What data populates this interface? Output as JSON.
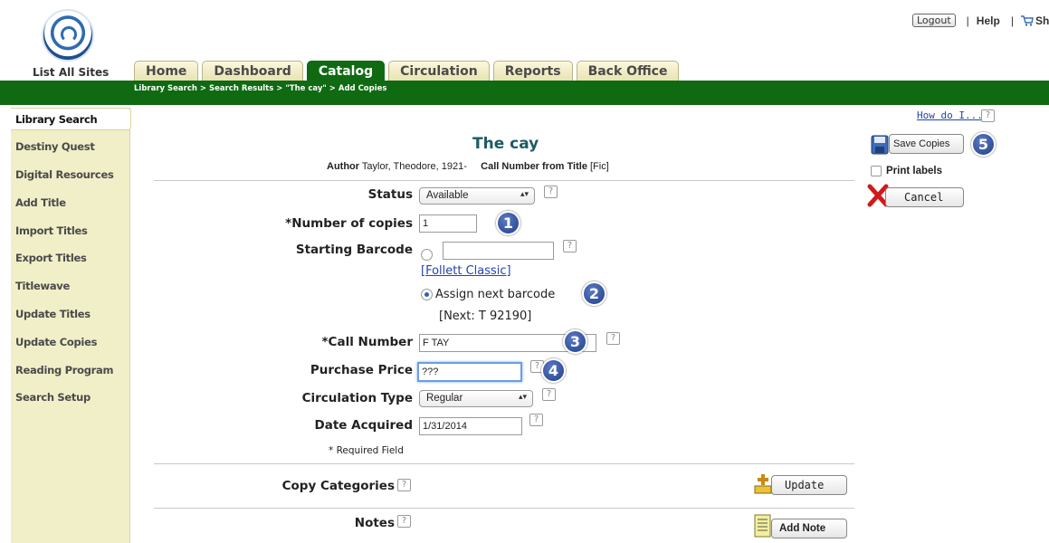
{
  "header": {
    "list_all_sites": "List All Sites",
    "logout": "Logout",
    "help": "Help",
    "shop": "Shop"
  },
  "tabs": [
    {
      "label": "Home",
      "active": false
    },
    {
      "label": "Dashboard",
      "active": false
    },
    {
      "label": "Catalog",
      "active": true
    },
    {
      "label": "Circulation",
      "active": false
    },
    {
      "label": "Reports",
      "active": false
    },
    {
      "label": "Back Office",
      "active": false
    }
  ],
  "breadcrumb": "Library Search > Search Results > \"The cay\" > Add Copies",
  "sidebar": {
    "items": [
      {
        "label": "Library Search",
        "active": true
      },
      {
        "label": "Destiny Quest"
      },
      {
        "label": "Digital Resources"
      },
      {
        "label": "Add Title"
      },
      {
        "label": "Import Titles"
      },
      {
        "label": "Export Titles"
      },
      {
        "label": "Titlewave"
      },
      {
        "label": "Update Titles"
      },
      {
        "label": "Update Copies"
      },
      {
        "label": "Reading Program"
      },
      {
        "label": "Search Setup"
      }
    ]
  },
  "help_link": "How do I...",
  "help_glyph": "?",
  "book": {
    "title": "The cay",
    "author_label": "Author",
    "author": "Taylor, Theodore, 1921-",
    "call_number_label": "Call Number from Title",
    "call_number": "[Fic]"
  },
  "form": {
    "status_label": "Status",
    "status_value": "Available",
    "copies_label": "*Number of copies",
    "copies_value": "1",
    "barcode_label": "Starting Barcode",
    "barcode_value": "",
    "follett_link": "[Follett Classic]",
    "assign_label": "Assign next barcode",
    "next_barcode": "[Next: T 92190]",
    "call_number_label": "*Call Number",
    "call_number_value": "F TAY",
    "price_label": "Purchase Price",
    "price_value": "???",
    "circ_type_label": "Circulation Type",
    "circ_type_value": "Regular",
    "date_label": "Date Acquired",
    "date_value": "1/31/2014",
    "required_note": "* Required Field",
    "copy_categories_label": "Copy Categories",
    "notes_label": "Notes",
    "update_button": "Update",
    "add_note_button": "Add Note"
  },
  "actions": {
    "save_copies": "Save Copies",
    "print_labels": "Print labels",
    "cancel": "Cancel"
  },
  "badges": [
    "1",
    "2",
    "3",
    "4",
    "5"
  ],
  "colors": {
    "brand_green": "#0f6a12",
    "sidebar_bg": "#f1efc8",
    "title_teal": "#1e5b63",
    "badge_blue": "#2d4f9e",
    "link_blue": "#2244aa"
  }
}
